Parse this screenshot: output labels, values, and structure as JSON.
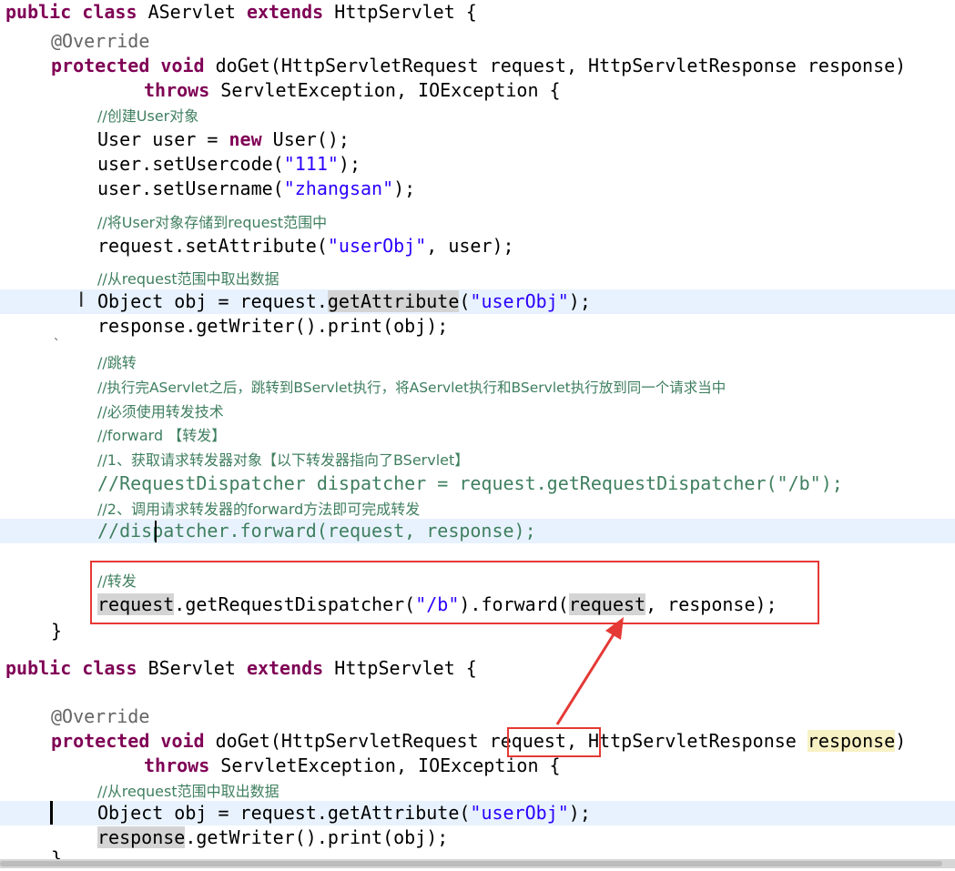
{
  "code": {
    "a": {
      "class_decl": {
        "kw1": "public",
        "kw2": "class",
        "name": "AServlet",
        "kw3": "extends",
        "base": "HttpServlet",
        "brace": "{"
      },
      "annotation": "@Override",
      "method_decl": {
        "kw1": "protected",
        "kw2": "void",
        "sig": "doGet(HttpServletRequest request, HttpServletResponse response)"
      },
      "throws_line": {
        "kw": "throws",
        "rest": "ServletException, IOException {"
      },
      "c1": "//创建User对象",
      "l1": {
        "type": "User user = ",
        "kw": "new",
        "rest": "User();"
      },
      "l2": {
        "pre": "user.setUsercode(",
        "str": "\"111\"",
        "post": ");"
      },
      "l3": {
        "pre": "user.setUsername(",
        "str": "\"zhangsan\"",
        "post": ");"
      },
      "c2": "//将User对象存储到request范围中",
      "l4": {
        "pre": "request.setAttribute(",
        "str": "\"userObj\"",
        "post": ", user);"
      },
      "c3": "//从request范围中取出数据",
      "l5": {
        "pre": "Object obj = request.",
        "method": "getAttribute",
        "mid": "(",
        "str": "\"userObj\"",
        "post": ");"
      },
      "l6": "response.getWriter().print(obj);",
      "fold": "`",
      "c4": "//跳转",
      "c5": "//执行完AServlet之后，跳转到BServlet执行，将AServlet执行和BServlet执行放到同一个请求当中",
      "c6": "//必须使用转发技术",
      "c7": "//forward 【转发】",
      "c8": "//1、获取请求转发器对象【以下转发器指向了BServlet】",
      "c9": "//RequestDispatcher dispatcher = request.getRequestDispatcher(\"/b\");",
      "c10": "//2、调用请求转发器的forward方法即可完成转发",
      "c11": "//dispatcher.forward(request, response);",
      "c12": "//转发",
      "l7": {
        "var": "request",
        "pre": ".getRequestDispatcher(",
        "str": "\"/b\"",
        "mid": ").forward(",
        "arg": "request",
        "post": ", response);"
      },
      "close": "}"
    },
    "b": {
      "class_decl": {
        "kw1": "public",
        "kw2": "class",
        "name": "BServlet",
        "kw3": "extends",
        "base": "HttpServlet",
        "brace": "{"
      },
      "annotation": "@Override",
      "method_decl": {
        "kw1": "protected",
        "kw2": "void",
        "pre": "doGet(HttpServletRequest ",
        "param1": "request",
        "mid": ", HttpServletResponse ",
        "param2": "response",
        "post": ")"
      },
      "throws_line": {
        "kw": "throws",
        "rest": "ServletException, IOException {"
      },
      "c1": "//从request范围中取出数据",
      "l1": {
        "pre": "Object obj = request.getAttribute(",
        "str": "\"userObj\"",
        "post": ");"
      },
      "l2": {
        "var": "response",
        "post": ".getWriter().print(obj);"
      },
      "close": "}"
    }
  },
  "colors": {
    "keyword": "#7f0055",
    "comment": "#3f7f5f",
    "string": "#2a00ff",
    "annotation": "#646464",
    "current_line": "#e8f2fe",
    "occurrence": "#d4d4d4",
    "annotation_box": "#e53935"
  }
}
